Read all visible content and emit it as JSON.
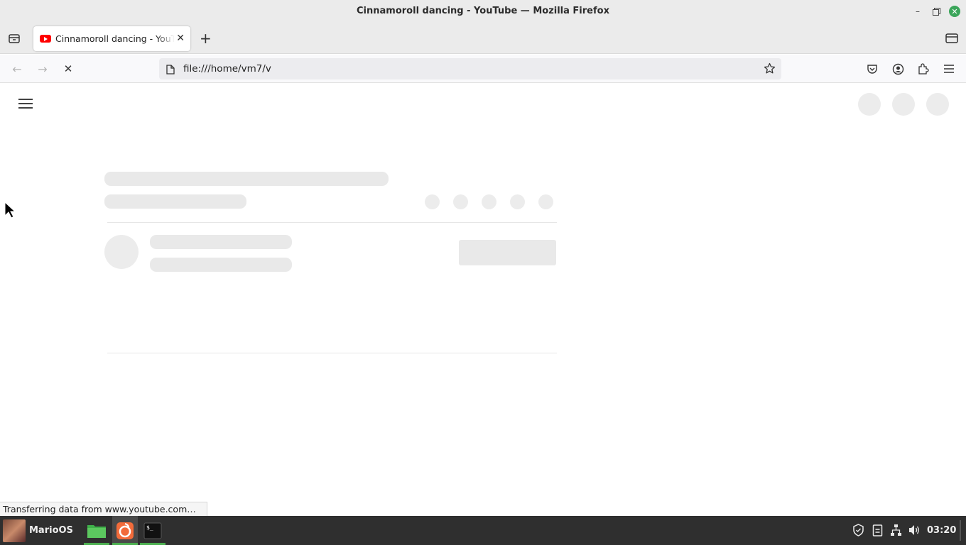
{
  "window": {
    "title": "Cinnamoroll dancing - YouTube — Mozilla Firefox",
    "minimize_icon": "minimize-icon",
    "maximize_icon": "maximize-icon",
    "close_icon": "close-icon"
  },
  "tabs": [
    {
      "label": "Cinnamoroll dancing - YouTube",
      "favicon": "youtube-icon",
      "active": true
    }
  ],
  "toolbar": {
    "url": "file:///home/vm7/v",
    "back_icon": "back-arrow-icon",
    "forward_icon": "forward-arrow-icon",
    "stop_icon": "stop-loading-icon",
    "bookmark_icon": "star-icon",
    "pocket_icon": "pocket-icon",
    "account_icon": "account-icon",
    "extensions_icon": "extensions-icon",
    "menu_icon": "hamburger-menu-icon"
  },
  "status": {
    "text": "Transferring data from www.youtube.com…"
  },
  "taskbar": {
    "menu_label": "MarioOS",
    "apps": [
      "files-icon",
      "firefox-icon",
      "terminal-icon"
    ],
    "tray": [
      "shield-icon",
      "clipboard-icon",
      "network-icon",
      "volume-icon"
    ],
    "clock": "03:20"
  },
  "colors": {
    "skeleton": "#e9e9e9",
    "taskbar": "#2f2f2f",
    "active_indicator": "#4caf50",
    "youtube_red": "#ff0000",
    "close_button": "#3ba55a"
  }
}
